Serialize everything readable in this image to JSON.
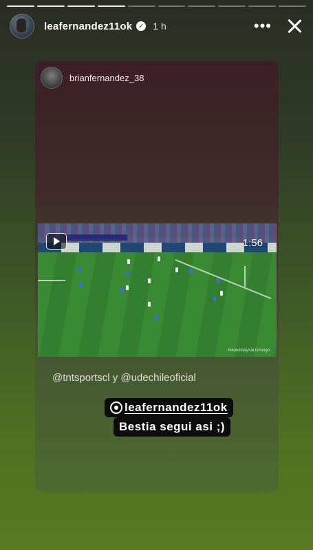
{
  "story": {
    "progress_segments": [
      1,
      1,
      1,
      1,
      0,
      0,
      0,
      0,
      0,
      0
    ],
    "author": {
      "username": "leafernandez11ok",
      "verified_mark": "✓",
      "time_ago": "1 h"
    },
    "controls": {
      "more": "•••",
      "close_icon": "close-icon"
    }
  },
  "shared_post": {
    "username": "brianfernandez_38",
    "video": {
      "duration": "1:56",
      "watermark": "#MatchdaySaDomingo",
      "icon": "reels-icon"
    },
    "caption": "@tntsportscl y @udechileoficial"
  },
  "mention_sticker": {
    "handle": "leafernandez11ok",
    "message": "Bestia segui asi ;)"
  },
  "colors": {
    "bg_top": "#2a2c24",
    "bg_bottom": "#587a1f",
    "card_top": "#3b1f25",
    "sticker": "#0c0c0c"
  }
}
